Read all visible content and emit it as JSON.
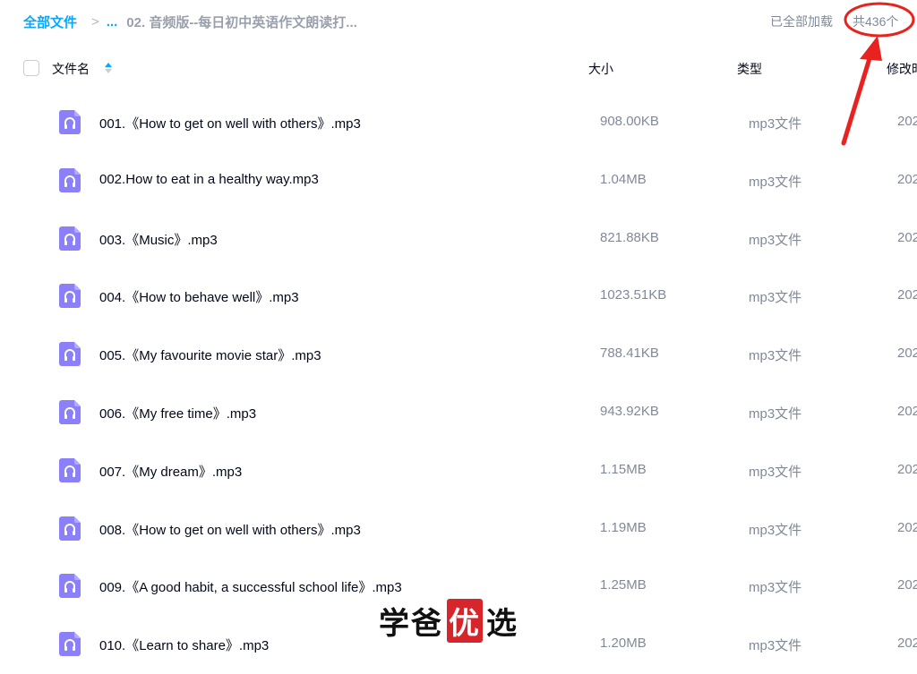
{
  "breadcrumb": {
    "root": "全部文件",
    "separator": ">",
    "ellipsis": "...",
    "current": "02. 音频版--每日初中英语作文朗读打..."
  },
  "status": {
    "loaded": "已全部加载",
    "total": "共436个"
  },
  "header": {
    "name": "文件名",
    "size": "大小",
    "type": "类型",
    "mtime": "修改时"
  },
  "files": [
    {
      "name": "001.《How to get on well with others》.mp3",
      "size": "908.00KB",
      "type": "mp3文件",
      "mtime": "202"
    },
    {
      "name": "002.How to eat in a healthy way.mp3",
      "size": "1.04MB",
      "type": "mp3文件",
      "mtime": "202"
    },
    {
      "name": "003.《Music》.mp3",
      "size": "821.88KB",
      "type": "mp3文件",
      "mtime": "202"
    },
    {
      "name": "004.《How to behave well》.mp3",
      "size": "1023.51KB",
      "type": "mp3文件",
      "mtime": "202"
    },
    {
      "name": "005.《My favourite movie star》.mp3",
      "size": "788.41KB",
      "type": "mp3文件",
      "mtime": "202"
    },
    {
      "name": "006.《My free time》.mp3",
      "size": "943.92KB",
      "type": "mp3文件",
      "mtime": "202"
    },
    {
      "name": "007.《My dream》.mp3",
      "size": "1.15MB",
      "type": "mp3文件",
      "mtime": "202"
    },
    {
      "name": "008.《How to get on well with others》.mp3",
      "size": "1.19MB",
      "type": "mp3文件",
      "mtime": "202"
    },
    {
      "name": "009.《A good habit, a successful school life》.mp3",
      "size": "1.25MB",
      "type": "mp3文件",
      "mtime": "202"
    },
    {
      "name": "010.《Learn to share》.mp3",
      "size": "1.20MB",
      "type": "mp3文件",
      "mtime": "202"
    }
  ],
  "icons": {
    "file": "audio-file-icon",
    "sort": "sort-icon"
  },
  "colors": {
    "accent": "#06a7ff",
    "audio_icon": "#8b80f9",
    "annotation": "#e8231f"
  },
  "watermark": {
    "part1": "学爸",
    "stamp": "优",
    "part2": "选"
  }
}
